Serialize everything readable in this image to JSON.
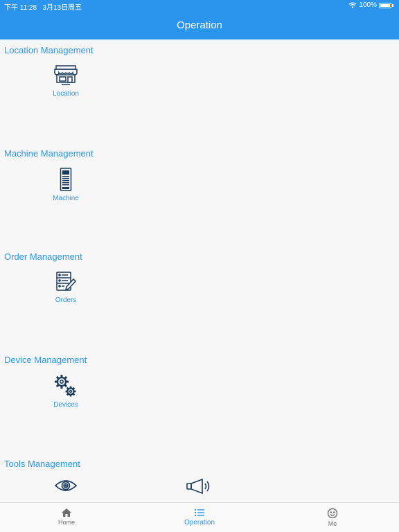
{
  "status_bar": {
    "time": "下午 11:28",
    "date": "3月13日周五",
    "battery": "100%"
  },
  "nav": {
    "title": "Operation"
  },
  "sections": [
    {
      "title": "Location Management",
      "items": [
        {
          "label": "Location",
          "icon": "store-icon"
        }
      ]
    },
    {
      "title": "Machine Management",
      "items": [
        {
          "label": "Machine",
          "icon": "vending-machine-icon"
        }
      ]
    },
    {
      "title": "Order Management",
      "items": [
        {
          "label": "Orders",
          "icon": "orders-edit-icon"
        }
      ]
    },
    {
      "title": "Device Management",
      "items": [
        {
          "label": "Devices",
          "icon": "gears-icon"
        }
      ]
    },
    {
      "title": "Tools Management",
      "items": [
        {
          "icon": "eye-icon"
        },
        {
          "icon": "megaphone-icon"
        }
      ]
    }
  ],
  "tabs": [
    {
      "label": "Home",
      "icon": "home-icon"
    },
    {
      "label": "Operation",
      "icon": "list-icon",
      "active": true
    },
    {
      "label": "Me",
      "icon": "smiley-icon"
    }
  ],
  "colors": {
    "accent": "#2b95ee",
    "icon_dark": "#1b3a5c",
    "background": "#f7f7f7"
  }
}
